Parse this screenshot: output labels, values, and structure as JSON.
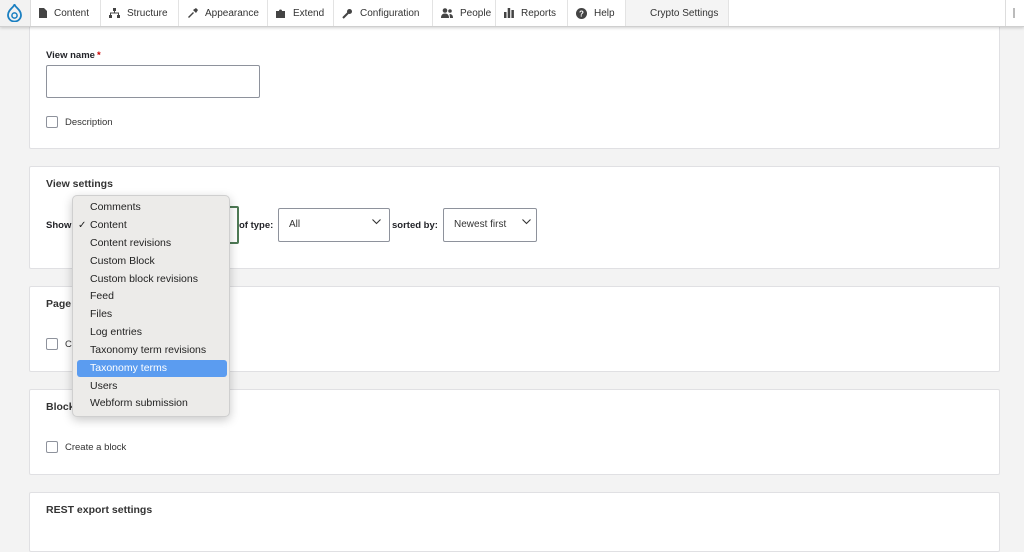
{
  "toolbar": {
    "items": [
      {
        "label": "Content",
        "icon": "file-icon"
      },
      {
        "label": "Structure",
        "icon": "sitemap-icon"
      },
      {
        "label": "Appearance",
        "icon": "brush-icon"
      },
      {
        "label": "Extend",
        "icon": "puzzle-icon"
      },
      {
        "label": "Configuration",
        "icon": "wrench-icon"
      },
      {
        "label": "People",
        "icon": "people-icon"
      },
      {
        "label": "Reports",
        "icon": "bar-chart-icon"
      },
      {
        "label": "Help",
        "icon": "help-icon"
      },
      {
        "label": "Crypto Settings",
        "icon": ""
      }
    ]
  },
  "view_name": {
    "label": "View name",
    "required_mark": "*",
    "value": ""
  },
  "description": {
    "label": "Description",
    "checked": false
  },
  "view_settings": {
    "title": "View settings",
    "show_label": "Show",
    "of_type_label": "of type:",
    "of_type_value": "All",
    "sorted_by_label": "sorted by:",
    "sorted_by_value": "Newest first"
  },
  "page_settings": {
    "title_partial": "Page",
    "checkbox_partial": "C"
  },
  "block_settings": {
    "title_partial": "Block",
    "create_label": "Create a block"
  },
  "rest_settings": {
    "title": "REST export settings"
  },
  "show_dropdown": {
    "selected": "Content",
    "highlighted": "Taxonomy terms",
    "options": [
      "Comments",
      "Content",
      "Content revisions",
      "Custom Block",
      "Custom block revisions",
      "Feed",
      "Files",
      "Log entries",
      "Taxonomy term revisions",
      "Taxonomy terms",
      "Users",
      "Webform submission"
    ]
  },
  "colors": {
    "accent_focus": "#4e7a55",
    "highlight": "#5b9cf0",
    "logo": "#1a7fc1"
  }
}
